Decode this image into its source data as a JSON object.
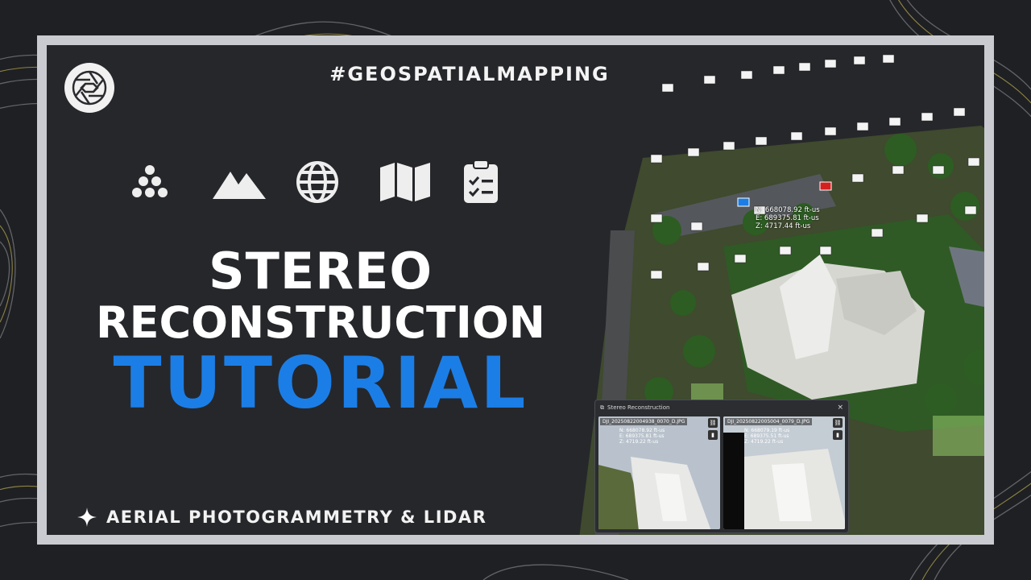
{
  "hashtag": "#GEOSPATIALMAPPING",
  "title": {
    "line1": "STEREO",
    "line2": "RECONSTRUCTION",
    "line3": "TUTORIAL"
  },
  "subtitle": "AERIAL PHOTOGRAMMETRY & LIDAR",
  "colors": {
    "accent": "#1b7ee6",
    "frame": "#c9cbd0",
    "background": "#1f2023"
  },
  "feature_icons": [
    "points-icon",
    "mountain-icon",
    "globe-icon",
    "map-icon",
    "clipboard-checklist-icon"
  ],
  "map_coords": {
    "n": "N: 668078.92 ft-us",
    "e": "E: 689375.81 ft-us",
    "z": "Z: 4717.44 ft-us"
  },
  "stereo_panel": {
    "title": "Stereo Reconstruction",
    "close": "×",
    "left_view": {
      "label": "DJI_20250822004938_0070_D.JPG",
      "n": "N: 668078.92 ft-us",
      "e": "E: 689375.81 ft-us",
      "z": "Z: 4719.22 ft-us"
    },
    "right_view": {
      "label": "DJI_20250822005004_0079_D.JPG",
      "n": "N: 668079.19 ft-us",
      "e": "E: 689375.51 ft-us",
      "z": "Z: 4719.22 ft-us"
    }
  }
}
